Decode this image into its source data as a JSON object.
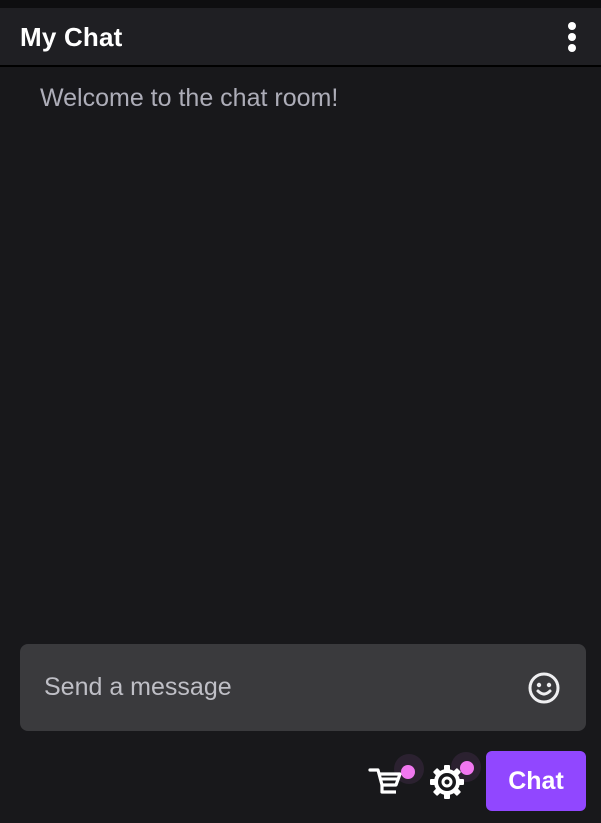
{
  "header": {
    "title": "My Chat",
    "menu_icon": "more-vertical-icon"
  },
  "messages": {
    "welcome": "Welcome to the chat room!"
  },
  "composer": {
    "placeholder": "Send a message",
    "value": "",
    "emoji_icon": "smiley-icon"
  },
  "actions": {
    "store_icon": "store-icon",
    "settings_icon": "gear-icon",
    "chat_label": "Chat"
  },
  "colors": {
    "background": "#18181b",
    "header": "#1f1f23",
    "input": "#3a3a3d",
    "accent": "#9147ff",
    "notification": "#f177f0",
    "muted_text": "#adadb8"
  }
}
